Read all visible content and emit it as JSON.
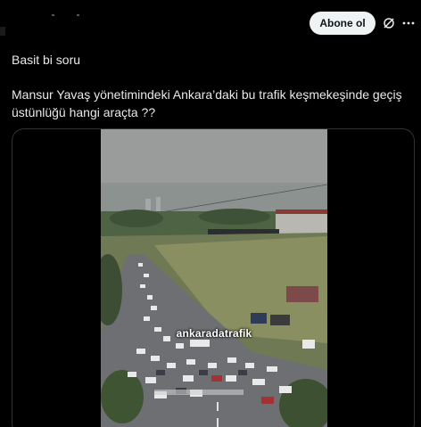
{
  "header": {
    "follow_label": "Abone ol",
    "icons": [
      "grok-icon",
      "more-icon"
    ]
  },
  "tweet": {
    "line1": "Basit bi soru",
    "line2": "Mansur Yavaş yönetimindeki Ankara’daki bu trafik keşmekeşinde geçiş",
    "line3": "üstünlüğü hangi araçta ??"
  },
  "media": {
    "watermark": "ankaradatrafik"
  },
  "colors": {
    "background": "#000000",
    "text": "#e7e9ea",
    "button_bg": "#eff3f4",
    "button_text": "#0f1419",
    "border": "#2f3336"
  }
}
